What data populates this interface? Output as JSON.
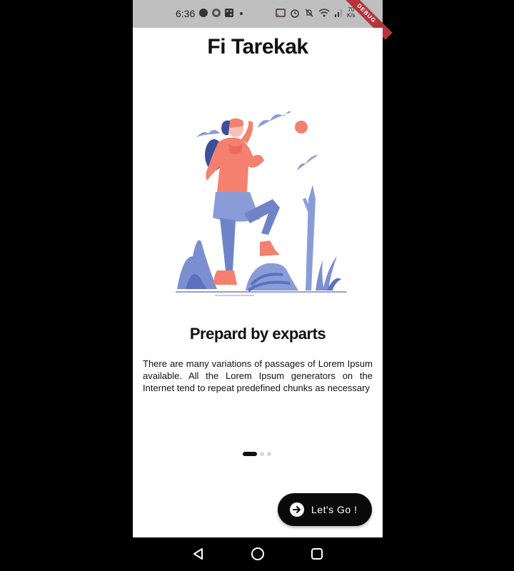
{
  "status_bar": {
    "time": "6:36",
    "network_speed_value": "70",
    "network_speed_unit": "K/s",
    "debug_label": "DEBUG"
  },
  "app": {
    "title": "Fi Tarekak"
  },
  "slide": {
    "title": "Prepard by exparts",
    "body": "There are many variations of passages of Lorem Ipsum available. All the Lorem Ipsum generators on the Internet tend to repeat predefined chunks as necessary"
  },
  "pager": {
    "count": 3,
    "active_index": 0
  },
  "cta": {
    "label": "Let's Go !",
    "icon": "arrow-right-icon"
  },
  "colors": {
    "accent": "#f4806f",
    "illustration_blue": "#7b8fd0",
    "button": "#0a0a0a"
  }
}
